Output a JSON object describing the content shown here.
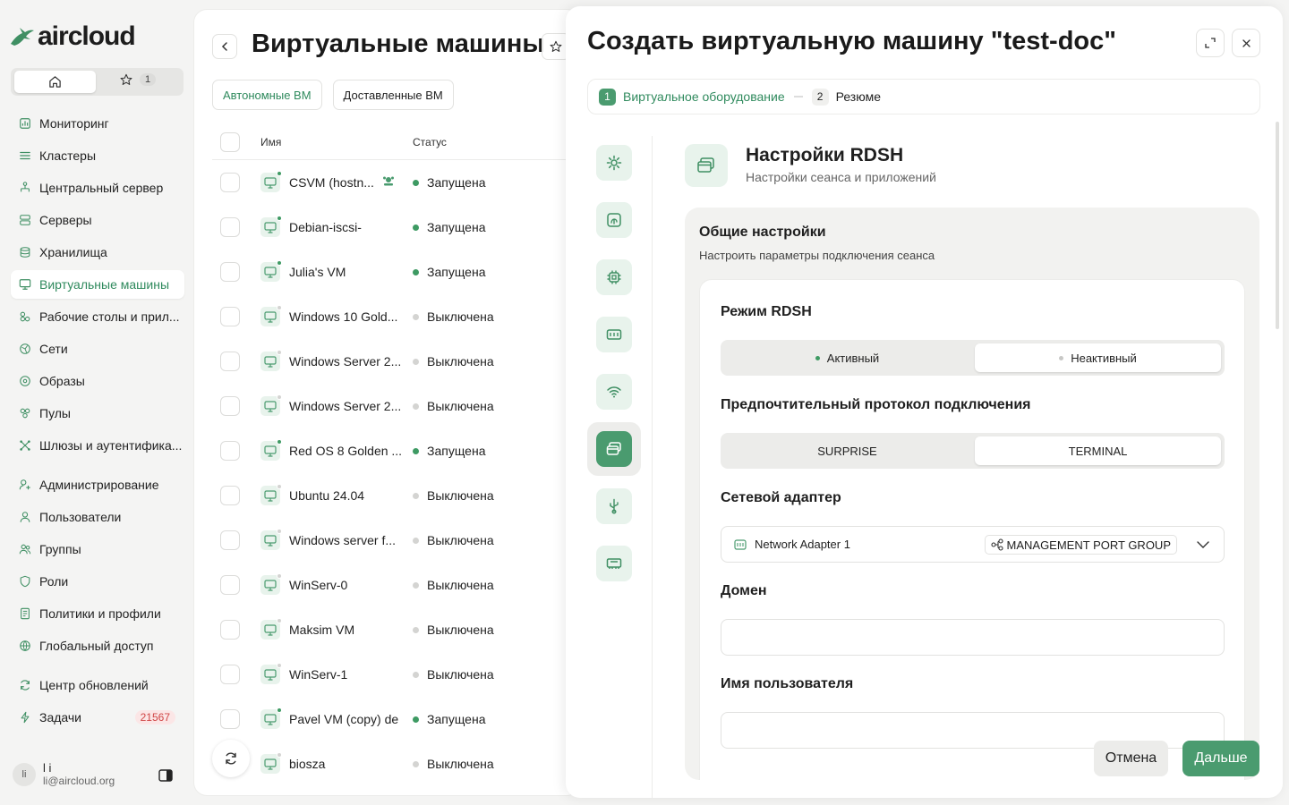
{
  "app": {
    "name": "aircloud",
    "brand_color": "#4a9b6f"
  },
  "quickbar": {
    "fav_count": "1"
  },
  "nav": {
    "items": [
      {
        "label": "Мониторинг",
        "icon": "chart-icon"
      },
      {
        "label": "Кластеры",
        "icon": "layers-icon"
      },
      {
        "label": "Центральный сервер",
        "icon": "hierarchy-icon"
      },
      {
        "label": "Серверы",
        "icon": "server-icon"
      },
      {
        "label": "Хранилища",
        "icon": "database-icon"
      },
      {
        "label": "Виртуальные машины",
        "icon": "monitor-icon",
        "active": true
      },
      {
        "label": "Рабочие столы и прил...",
        "icon": "apps-icon"
      },
      {
        "label": "Сети",
        "icon": "network-icon"
      },
      {
        "label": "Образы",
        "icon": "disc-icon"
      },
      {
        "label": "Пулы",
        "icon": "pool-icon"
      },
      {
        "label": "Шлюзы и аутентифика...",
        "icon": "gateway-icon"
      },
      {
        "label": "Администрирование",
        "icon": "admin-icon"
      },
      {
        "label": "Пользователи",
        "icon": "user-icon"
      },
      {
        "label": "Группы",
        "icon": "users-icon"
      },
      {
        "label": "Роли",
        "icon": "shield-icon"
      },
      {
        "label": "Политики и профили",
        "icon": "policy-icon"
      },
      {
        "label": "Глобальный доступ",
        "icon": "globe-icon"
      },
      {
        "label": "Центр обновлений",
        "icon": "refresh-icon"
      },
      {
        "label": "Задачи",
        "icon": "bolt-icon",
        "badge": "21567"
      }
    ]
  },
  "user": {
    "initials": "li",
    "name": "l i",
    "email": "li@aircloud.org"
  },
  "list": {
    "title": "Виртуальные машины",
    "tabs": [
      {
        "label": "Автономные ВМ",
        "active": true
      },
      {
        "label": "Доставленные ВМ"
      }
    ],
    "columns": {
      "name": "Имя",
      "status": "Статус"
    },
    "status_colors": {
      "running": "#3e9a63",
      "stopped": "#d4d4d2"
    },
    "rows": [
      {
        "name": "CSVM (hostn...",
        "status": "Запущена",
        "state": "running",
        "extra": true
      },
      {
        "name": "Debian-iscsi-",
        "status": "Запущена",
        "state": "running"
      },
      {
        "name": "Julia's VM",
        "status": "Запущена",
        "state": "running"
      },
      {
        "name": "Windows 10 Gold...",
        "status": "Выключена",
        "state": "stopped"
      },
      {
        "name": "Windows Server 2...",
        "status": "Выключена",
        "state": "stopped"
      },
      {
        "name": "Windows Server 2...",
        "status": "Выключена",
        "state": "stopped"
      },
      {
        "name": "Red OS 8 Golden ...",
        "status": "Запущена",
        "state": "running"
      },
      {
        "name": "Ubuntu 24.04",
        "status": "Выключена",
        "state": "stopped"
      },
      {
        "name": "Windows server f...",
        "status": "Выключена",
        "state": "stopped"
      },
      {
        "name": "WinServ-0",
        "status": "Выключена",
        "state": "stopped"
      },
      {
        "name": "Maksim VM",
        "status": "Выключена",
        "state": "stopped"
      },
      {
        "name": "WinServ-1",
        "status": "Выключена",
        "state": "stopped"
      },
      {
        "name": "Pavel VM (copy) de",
        "status": "Запущена",
        "state": "running"
      },
      {
        "name": "biosza",
        "status": "Выключена",
        "state": "stopped"
      }
    ]
  },
  "modal": {
    "title": "Создать виртуальную машину \"test-doc\"",
    "steps": [
      {
        "num": "1",
        "label": "Виртуальное оборудование",
        "active": true
      },
      {
        "num": "2",
        "label": "Резюме"
      }
    ],
    "rail": [
      {
        "icon": "settings-icon"
      },
      {
        "icon": "fingerprint-icon"
      },
      {
        "icon": "cpu-icon"
      },
      {
        "icon": "memory-icon"
      },
      {
        "icon": "wifi-icon"
      },
      {
        "icon": "rdsh-icon",
        "active": true
      },
      {
        "icon": "usb-icon"
      },
      {
        "icon": "ram-icon"
      }
    ],
    "section": {
      "title": "Настройки RDSH",
      "subtitle": "Настройки сеанса и приложений"
    },
    "card": {
      "title": "Общие настройки",
      "subtitle": "Настроить параметры подключения сеанса"
    },
    "rdsh_mode": {
      "label": "Режим RDSH",
      "options": [
        {
          "label": "Активный",
          "dot": "#3e9a63"
        },
        {
          "label": "Неактивный",
          "dot": "#c8c8c6"
        }
      ],
      "selected": "Неактивный"
    },
    "protocol": {
      "label": "Предпочтительный протокол подключения",
      "options": [
        {
          "label": "SURPRISE"
        },
        {
          "label": "TERMINAL"
        }
      ],
      "selected": "TERMINAL"
    },
    "adapter": {
      "label": "Сетевой адаптер",
      "value": "Network Adapter 1",
      "port_group": "MANAGEMENT PORT GROUP"
    },
    "domain": {
      "label": "Домен",
      "value": ""
    },
    "username": {
      "label": "Имя пользователя",
      "value": ""
    },
    "buttons": {
      "cancel": "Отмена",
      "next": "Дальше"
    }
  }
}
